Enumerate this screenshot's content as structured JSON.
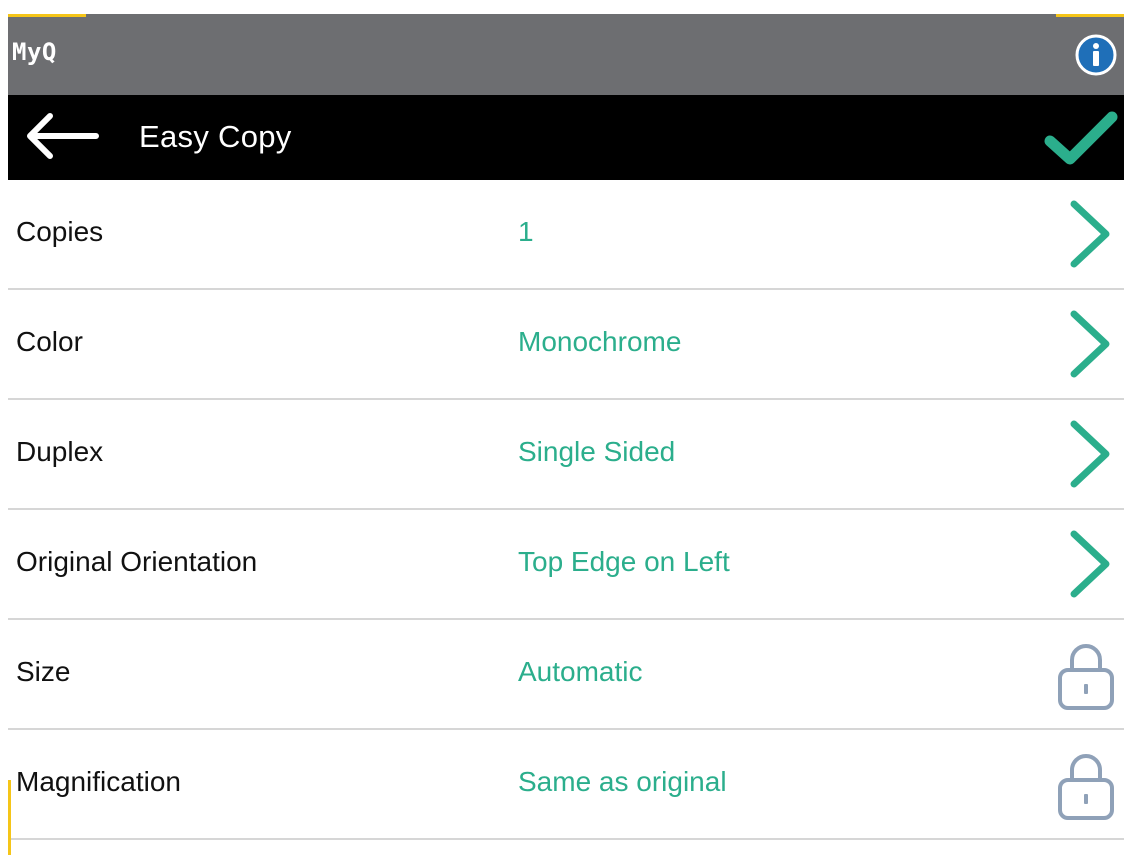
{
  "app": {
    "brand": "MyQ"
  },
  "header": {
    "title": "Easy Copy",
    "back_icon": "arrow-left-icon",
    "confirm_icon": "checkmark-icon",
    "info_icon": "info-icon"
  },
  "colors": {
    "topbar": "#6d6e71",
    "titlebar": "#000000",
    "accent_yellow": "#f5c518",
    "value_teal": "#2bae8c",
    "info_blue": "#1f6fb8",
    "lock_gray": "#8fa1b8"
  },
  "settings": [
    {
      "label": "Copies",
      "value": "1",
      "icon": "chevron-right-icon"
    },
    {
      "label": "Color",
      "value": "Monochrome",
      "icon": "chevron-right-icon"
    },
    {
      "label": "Duplex",
      "value": "Single Sided",
      "icon": "chevron-right-icon"
    },
    {
      "label": "Original Orientation",
      "value": "Top Edge on Left",
      "icon": "chevron-right-icon"
    },
    {
      "label": "Size",
      "value": "Automatic",
      "icon": "lock-icon"
    },
    {
      "label": "Magnification",
      "value": "Same as original",
      "icon": "lock-icon"
    }
  ]
}
